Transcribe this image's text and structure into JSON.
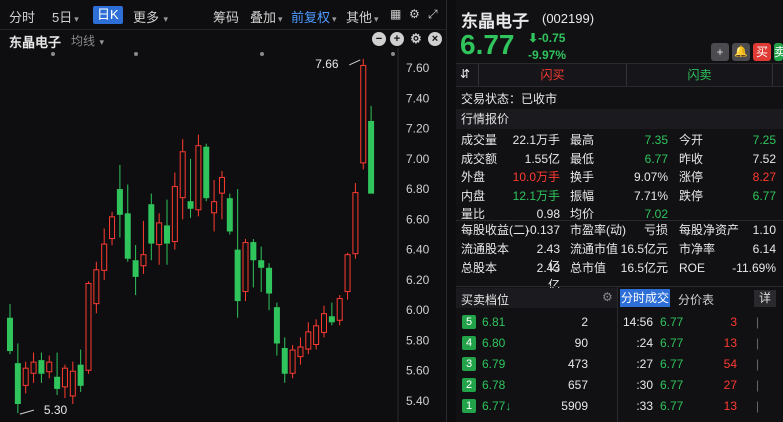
{
  "toolbar": {
    "items": [
      "分时",
      "5日",
      "日K",
      "更多",
      "筹码",
      "叠加",
      "前复权",
      "其他"
    ]
  },
  "subbar": {
    "stock_name": "东晶电子",
    "indicator": "均线"
  },
  "chart_data": {
    "type": "candlestick",
    "y_ticks": [
      "7.60",
      "7.40",
      "7.20",
      "7.00",
      "6.80",
      "6.60",
      "6.40",
      "6.20",
      "6.00",
      "5.80",
      "5.60",
      "5.40"
    ],
    "ylim": [
      5.32,
      7.72
    ],
    "high_label": "7.66",
    "low_label": "5.30",
    "up_color": "#ff3b30",
    "down_color": "#2fc45c",
    "candles": [
      {
        "o": 5.95,
        "c": 5.73,
        "h": 6.04,
        "l": 5.71
      },
      {
        "o": 5.65,
        "c": 5.38,
        "h": 5.78,
        "l": 5.32
      },
      {
        "o": 5.5,
        "c": 5.62,
        "h": 5.66,
        "l": 5.45
      },
      {
        "o": 5.58,
        "c": 5.66,
        "h": 5.72,
        "l": 5.52
      },
      {
        "o": 5.67,
        "c": 5.58,
        "h": 5.72,
        "l": 5.52
      },
      {
        "o": 5.59,
        "c": 5.66,
        "h": 5.7,
        "l": 5.55
      },
      {
        "o": 5.56,
        "c": 5.48,
        "h": 5.72,
        "l": 5.44
      },
      {
        "o": 5.49,
        "c": 5.62,
        "h": 5.64,
        "l": 5.42
      },
      {
        "o": 5.43,
        "c": 5.6,
        "h": 5.66,
        "l": 5.38
      },
      {
        "o": 5.64,
        "c": 5.5,
        "h": 5.74,
        "l": 5.46
      },
      {
        "o": 5.6,
        "c": 6.18,
        "h": 6.19,
        "l": 5.58
      },
      {
        "o": 6.04,
        "c": 6.27,
        "h": 6.32,
        "l": 5.98
      },
      {
        "o": 6.26,
        "c": 6.44,
        "h": 6.54,
        "l": 6.2
      },
      {
        "o": 6.47,
        "c": 6.62,
        "h": 6.65,
        "l": 6.43
      },
      {
        "o": 6.8,
        "c": 6.63,
        "h": 6.96,
        "l": 6.48
      },
      {
        "o": 6.64,
        "c": 6.34,
        "h": 6.83,
        "l": 6.32
      },
      {
        "o": 6.33,
        "c": 6.22,
        "h": 6.43,
        "l": 6.1
      },
      {
        "o": 6.29,
        "c": 6.37,
        "h": 6.59,
        "l": 6.24
      },
      {
        "o": 6.7,
        "c": 6.44,
        "h": 6.77,
        "l": 6.33
      },
      {
        "o": 6.43,
        "c": 6.58,
        "h": 6.64,
        "l": 6.3
      },
      {
        "o": 6.56,
        "c": 6.44,
        "h": 6.73,
        "l": 6.3
      },
      {
        "o": 6.45,
        "c": 6.82,
        "h": 6.91,
        "l": 6.4
      },
      {
        "o": 6.74,
        "c": 7.05,
        "h": 7.13,
        "l": 6.6
      },
      {
        "o": 6.72,
        "c": 6.67,
        "h": 7.0,
        "l": 6.61
      },
      {
        "o": 6.66,
        "c": 7.09,
        "h": 7.16,
        "l": 6.62
      },
      {
        "o": 7.08,
        "c": 6.74,
        "h": 7.1,
        "l": 6.72
      },
      {
        "o": 6.64,
        "c": 6.72,
        "h": 6.86,
        "l": 6.52
      },
      {
        "o": 6.77,
        "c": 6.88,
        "h": 6.92,
        "l": 6.6
      },
      {
        "o": 6.74,
        "c": 6.52,
        "h": 6.77,
        "l": 6.5
      },
      {
        "o": 6.4,
        "c": 6.06,
        "h": 6.8,
        "l": 5.95
      },
      {
        "o": 6.12,
        "c": 6.45,
        "h": 6.47,
        "l": 6.06
      },
      {
        "o": 6.45,
        "c": 6.33,
        "h": 6.47,
        "l": 6.15
      },
      {
        "o": 6.33,
        "c": 6.28,
        "h": 6.42,
        "l": 6.12
      },
      {
        "o": 6.28,
        "c": 6.11,
        "h": 6.31,
        "l": 6.0
      },
      {
        "o": 6.02,
        "c": 5.78,
        "h": 6.05,
        "l": 5.7
      },
      {
        "o": 5.75,
        "c": 5.58,
        "h": 5.82,
        "l": 5.52
      },
      {
        "o": 5.58,
        "c": 5.74,
        "h": 5.77,
        "l": 5.55
      },
      {
        "o": 5.69,
        "c": 5.76,
        "h": 5.82,
        "l": 5.64
      },
      {
        "o": 5.74,
        "c": 5.86,
        "h": 5.92,
        "l": 5.71
      },
      {
        "o": 5.77,
        "c": 5.9,
        "h": 5.94,
        "l": 5.74
      },
      {
        "o": 5.85,
        "c": 5.98,
        "h": 6.03,
        "l": 5.82
      },
      {
        "o": 5.96,
        "c": 5.92,
        "h": 6.05,
        "l": 5.9
      },
      {
        "o": 5.93,
        "c": 6.08,
        "h": 6.1,
        "l": 5.9
      },
      {
        "o": 6.12,
        "c": 6.37,
        "h": 6.38,
        "l": 6.07
      },
      {
        "o": 6.37,
        "c": 6.78,
        "h": 6.84,
        "l": 6.34
      },
      {
        "o": 6.97,
        "c": 7.62,
        "h": 7.66,
        "l": 6.93
      },
      {
        "o": 7.25,
        "c": 6.77,
        "h": 7.35,
        "l": 6.77
      }
    ]
  },
  "quote": {
    "name": "东晶电子",
    "code": "(002199)",
    "price": "6.77",
    "change": "-0.75",
    "change_pct": "-9.97%",
    "tab_buy": "闪买",
    "tab_sell": "闪卖",
    "buttons": [
      "+",
      "买",
      "卖"
    ],
    "status": "交易状态：已收市",
    "section_title": "行情报价",
    "stats": [
      [
        "成交量",
        "22.1万手",
        "最高",
        "7.35",
        "今开",
        "7.25"
      ],
      [
        "成交额",
        "1.55亿",
        "最低",
        "6.77",
        "昨收",
        "7.52"
      ],
      [
        "外盘",
        "10.0万手",
        "换手",
        "9.07%",
        "涨停",
        "8.27"
      ],
      [
        "内盘",
        "12.1万手",
        "振幅",
        "7.71%",
        "跌停",
        "6.77"
      ],
      [
        "量比",
        "0.98",
        "均价",
        "7.02",
        "",
        ""
      ]
    ],
    "fundamentals": [
      [
        "每股收益(二)",
        "-0.137",
        "市盈率(动)",
        "亏损",
        "每股净资产",
        "1.10"
      ],
      [
        "流通股本",
        "2.43亿",
        "流通市值",
        "16.5亿元",
        "市净率",
        "6.14"
      ],
      [
        "总股本",
        "2.43亿",
        "总市值",
        "16.5亿元",
        "ROE",
        "-11.69%"
      ]
    ]
  },
  "orderbook": {
    "title": "买卖档位",
    "rows": [
      {
        "n": "5",
        "price": "6.81",
        "vol": "2"
      },
      {
        "n": "4",
        "price": "6.80",
        "vol": "90"
      },
      {
        "n": "3",
        "price": "6.79",
        "vol": "473"
      },
      {
        "n": "2",
        "price": "6.78",
        "vol": "657"
      },
      {
        "n": "1",
        "price": "6.77↓",
        "vol": "5909"
      }
    ]
  },
  "ticks": {
    "tab_active": "分时成交",
    "tab_other": "分价表",
    "detail": "详",
    "rows": [
      {
        "t": "14:56",
        "p": "6.77",
        "v": "3"
      },
      {
        "t": ":24",
        "p": "6.77",
        "v": "13"
      },
      {
        "t": ":27",
        "p": "6.77",
        "v": "54"
      },
      {
        "t": ":30",
        "p": "6.77",
        "v": "27"
      },
      {
        "t": ":33",
        "p": "6.77",
        "v": "13"
      }
    ]
  }
}
